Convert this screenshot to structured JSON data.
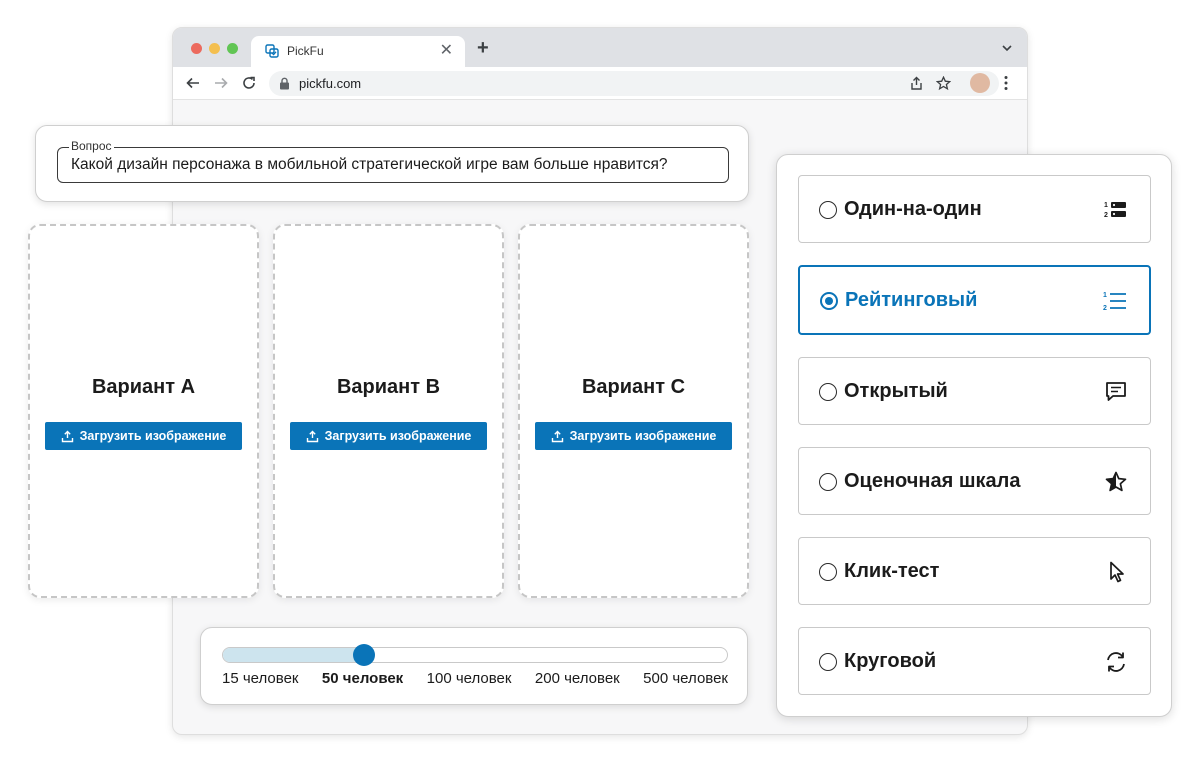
{
  "browser": {
    "tab_title": "PickFu",
    "tab_close": "✕",
    "new_tab": "+",
    "url": "pickfu.com"
  },
  "question": {
    "legend": "Вопрос",
    "value": "Какой дизайн персонажа в мобильной стратегической игре вам больше нравится?"
  },
  "variants": [
    {
      "title": "Вариант A",
      "button": "Загрузить изображение"
    },
    {
      "title": "Вариант B",
      "button": "Загрузить изображение"
    },
    {
      "title": "Вариант C",
      "button": "Загрузить изображение"
    }
  ],
  "audience": {
    "options": [
      "15 человек",
      "50 человек",
      "100 человек",
      "200 человек",
      "500 человек"
    ],
    "selected_index": 1,
    "selected": "50 человек"
  },
  "test_types": {
    "selected": "Рейтинговый",
    "options": [
      {
        "label": "Один-на-один",
        "icon": "head-to-head-icon"
      },
      {
        "label": "Рейтинговый",
        "icon": "ranked-list-icon"
      },
      {
        "label": "Открытый",
        "icon": "comment-icon"
      },
      {
        "label": "Оценочная шкала",
        "icon": "star-rating-icon"
      },
      {
        "label": "Клик-тест",
        "icon": "cursor-icon"
      },
      {
        "label": "Круговой",
        "icon": "refresh-icon"
      }
    ]
  },
  "colors": {
    "accent": "#0a74b8",
    "track_fill": "#cde4ee"
  }
}
